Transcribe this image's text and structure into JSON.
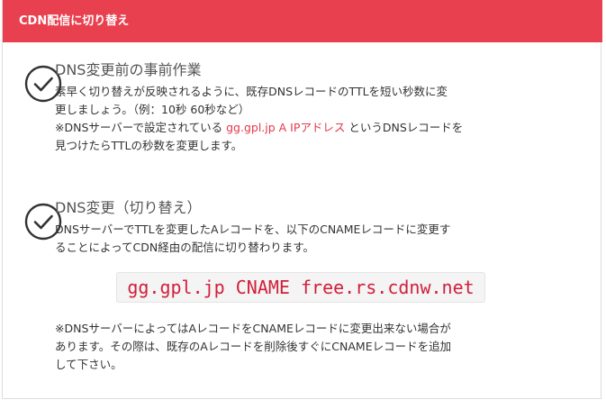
{
  "header": {
    "title": "CDN配信に切り替え"
  },
  "step1": {
    "title": "DNS変更前の事前作業",
    "line1": "素早く切り替えが反映されるように、既存DNSレコードのTTLを短い秒数に変",
    "line2": "更しましょう。（例：10秒 60秒など）",
    "line3_prefix": "※DNSサーバーで設定されている ",
    "line3_link": "gg.gpl.jp A IPアドレス",
    "line3_suffix": " というDNSレコードを",
    "line4": "見つけたらTTLの秒数を変更します。"
  },
  "step2": {
    "title": "DNS変更（切り替え）",
    "line1": "DNSサーバーでTTLを変更したAレコードを、以下のCNAMEレコードに変更す",
    "line2": "ることによってCDN経由の配信に切り替わります。",
    "code": "gg.gpl.jp CNAME free.rs.cdnw.net",
    "note1": "※DNSサーバーによってはAレコードをCNAMEレコードに変更出来ない場合が",
    "note2": "あります。その際は、既存のAレコードを削除後すぐにCNAMEレコードを追加",
    "note3": "して下さい。"
  },
  "icons": {
    "step1_icon": "check-circle-icon",
    "step2_icon": "check-circle-icon"
  },
  "colors": {
    "header_bg": "#e8404f",
    "link": "#e23a4a",
    "code_text": "#d0203a"
  }
}
